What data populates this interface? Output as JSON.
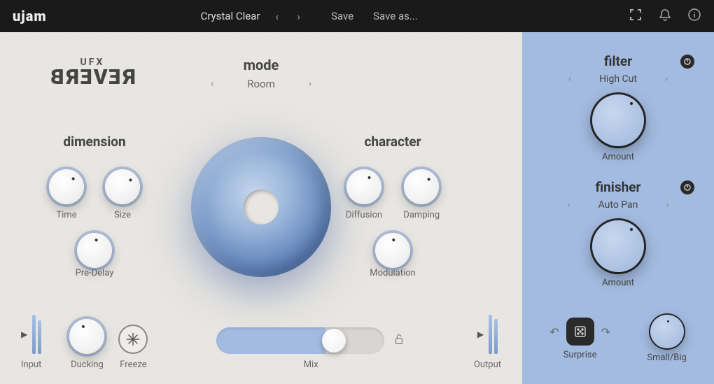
{
  "topbar": {
    "logo": "ujam",
    "preset": "Crystal Clear",
    "save": "Save",
    "saveas": "Save as..."
  },
  "brand": {
    "ufx": "UFX",
    "reverb": "REVERB"
  },
  "mode": {
    "title": "mode",
    "value": "Room"
  },
  "dimension": {
    "title": "dimension",
    "time": "Time",
    "size": "Size",
    "predelay": "Pre-Delay"
  },
  "character": {
    "title": "character",
    "diffusion": "Diffusion",
    "damping": "Damping",
    "modulation": "Modulation"
  },
  "io": {
    "input": "Input",
    "output": "Output",
    "ducking": "Ducking",
    "freeze": "Freeze",
    "mix": "Mix"
  },
  "filter": {
    "title": "filter",
    "value": "High Cut",
    "amount": "Amount"
  },
  "finisher": {
    "title": "finisher",
    "value": "Auto Pan",
    "amount": "Amount"
  },
  "surprise": {
    "label": "Surprise",
    "smallbig": "Small/Big"
  }
}
